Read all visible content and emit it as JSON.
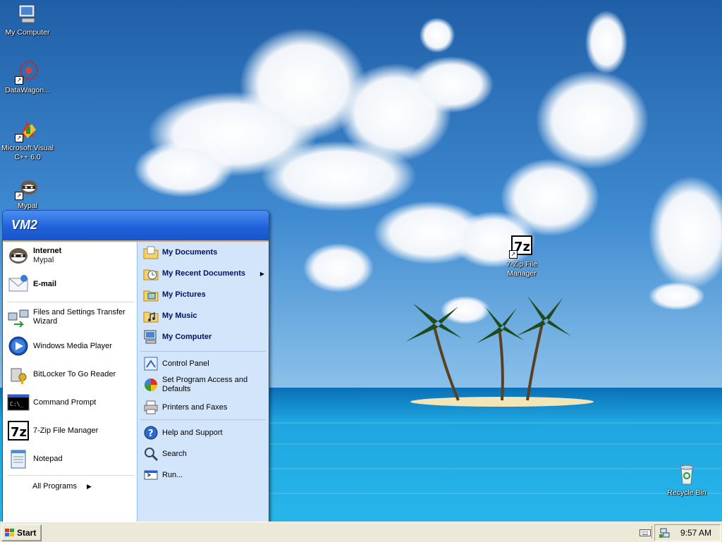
{
  "desktop": {
    "icons": [
      {
        "label": "My Computer",
        "icon": "my-computer-icon"
      },
      {
        "label": "DataWagon...",
        "icon": "datawagon-icon"
      },
      {
        "label": "Microsoft Visual C++ 6.0",
        "icon": "visual-cpp-icon"
      },
      {
        "label": "Mypal",
        "icon": "mypal-icon"
      },
      {
        "label": "7-Zip File Manager",
        "icon": "seven-zip-icon"
      },
      {
        "label": "Recycle Bin",
        "icon": "recycle-bin-icon"
      }
    ]
  },
  "start_menu": {
    "user": "VM2",
    "pinned": [
      {
        "title": "Internet",
        "subtitle": "Mypal",
        "icon": "mypal-icon"
      },
      {
        "title": "E-mail",
        "icon": "email-icon"
      }
    ],
    "recent": [
      {
        "label": "Files and Settings Transfer Wizard",
        "icon": "transfer-wizard-icon"
      },
      {
        "label": "Windows Media Player",
        "icon": "media-player-icon"
      },
      {
        "label": "BitLocker To Go Reader",
        "icon": "bitlocker-icon"
      },
      {
        "label": "Command Prompt",
        "icon": "command-prompt-icon"
      },
      {
        "label": "7-Zip File Manager",
        "icon": "seven-zip-icon"
      },
      {
        "label": "Notepad",
        "icon": "notepad-icon"
      }
    ],
    "all_programs": "All Programs",
    "places": [
      {
        "label": "My Documents",
        "icon": "my-documents-icon"
      },
      {
        "label": "My Recent Documents",
        "icon": "recent-documents-icon"
      },
      {
        "label": "My Pictures",
        "icon": "my-pictures-icon"
      },
      {
        "label": "My Music",
        "icon": "my-music-icon"
      },
      {
        "label": "My Computer",
        "icon": "my-computer-icon"
      }
    ],
    "settings": [
      {
        "label": "Control Panel",
        "icon": "control-panel-icon"
      },
      {
        "label": "Set Program Access and Defaults",
        "icon": "program-defaults-icon"
      },
      {
        "label": "Printers and Faxes",
        "icon": "printer-icon"
      }
    ],
    "tools": [
      {
        "label": "Help and Support",
        "icon": "help-icon"
      },
      {
        "label": "Search",
        "icon": "search-icon"
      },
      {
        "label": "Run...",
        "icon": "run-icon"
      }
    ]
  },
  "taskbar": {
    "start_label": "Start",
    "clock": "9:57 AM"
  }
}
